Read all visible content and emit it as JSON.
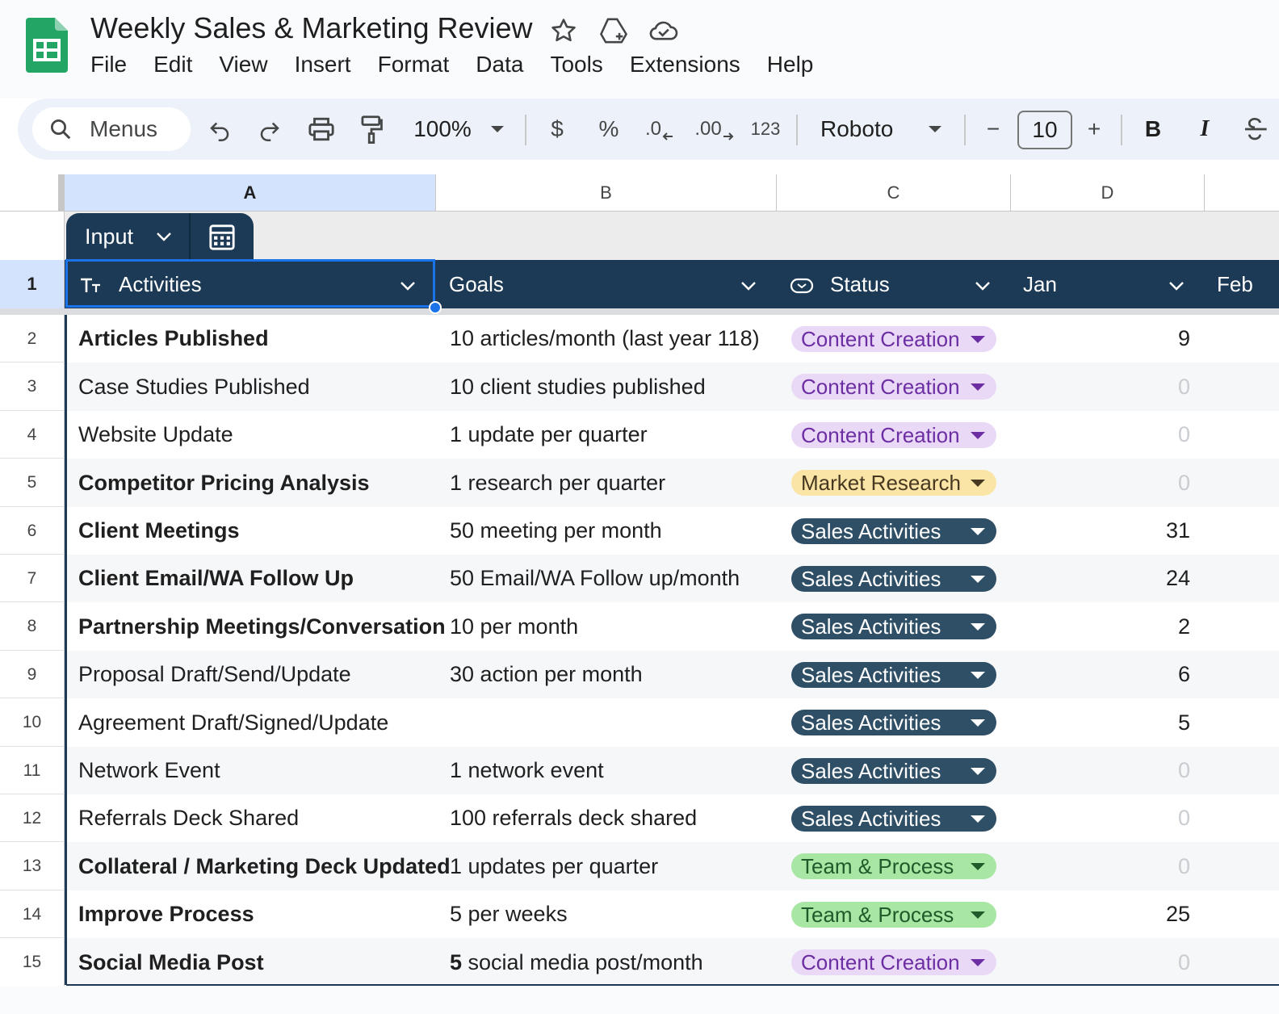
{
  "app": {
    "title": "Weekly Sales & Marketing Review",
    "menu": [
      "File",
      "Edit",
      "View",
      "Insert",
      "Format",
      "Data",
      "Tools",
      "Extensions",
      "Help"
    ]
  },
  "toolbar": {
    "search_label": "Menus",
    "zoom": "100%",
    "currency": "$",
    "percent": "%",
    "decrease_decimal": ".0",
    "increase_decimal": ".00",
    "number_format": "123",
    "font": "Roboto",
    "font_size": "10",
    "minus": "−",
    "plus": "+",
    "bold": "B",
    "italic": "I"
  },
  "columns": [
    "A",
    "B",
    "C",
    "D"
  ],
  "table": {
    "name": "Input",
    "header_row_number": "1",
    "headers": {
      "activities": "Activities",
      "goals": "Goals",
      "status": "Status",
      "jan": "Jan",
      "feb": "Feb"
    }
  },
  "status_colors": {
    "Content Creation": {
      "bg": "#e9d9f6",
      "fg": "#6c2ea2"
    },
    "Market Research": {
      "bg": "#fbe5a6",
      "fg": "#473821"
    },
    "Sales Activities": {
      "bg": "#2f4f66",
      "fg": "#ffffff"
    },
    "Team & Process": {
      "bg": "#a8e6a3",
      "fg": "#1f5a2a"
    }
  },
  "rows": [
    {
      "n": "2",
      "activity": "Articles Published",
      "bold": true,
      "goal": "10 articles/month (last year 118)",
      "status": "Content Creation",
      "jan": "9"
    },
    {
      "n": "3",
      "activity": "Case Studies Published",
      "bold": false,
      "goal": "10 client studies published",
      "status": "Content Creation",
      "jan": "0"
    },
    {
      "n": "4",
      "activity": "Website Update",
      "bold": false,
      "goal": "1 update per quarter",
      "status": "Content Creation",
      "jan": "0"
    },
    {
      "n": "5",
      "activity": "Competitor Pricing Analysis",
      "bold": true,
      "goal": "1 research per quarter",
      "status": "Market Research",
      "jan": "0"
    },
    {
      "n": "6",
      "activity": "Client Meetings",
      "bold": true,
      "goal": "50 meeting per month",
      "status": "Sales Activities",
      "jan": "31"
    },
    {
      "n": "7",
      "activity": "Client Email/WA Follow Up",
      "bold": true,
      "goal": "50 Email/WA Follow up/month",
      "status": "Sales Activities",
      "jan": "24"
    },
    {
      "n": "8",
      "activity": "Partnership Meetings/Conversation",
      "bold": true,
      "goal": "10 per month",
      "status": "Sales Activities",
      "jan": "2"
    },
    {
      "n": "9",
      "activity": "Proposal Draft/Send/Update",
      "bold": false,
      "goal": "30 action per month",
      "status": "Sales Activities",
      "jan": "6"
    },
    {
      "n": "10",
      "activity": "Agreement Draft/Signed/Update",
      "bold": false,
      "goal": "",
      "status": "Sales Activities",
      "jan": "5"
    },
    {
      "n": "11",
      "activity": "Network Event",
      "bold": false,
      "goal": "1 network event",
      "status": "Sales Activities",
      "jan": "0"
    },
    {
      "n": "12",
      "activity": "Referrals Deck Shared",
      "bold": false,
      "goal": "100 referrals deck shared",
      "status": "Sales Activities",
      "jan": "0"
    },
    {
      "n": "13",
      "activity": "Collateral / Marketing Deck Updated",
      "bold": true,
      "goal": "1 updates per quarter",
      "status": "Team & Process",
      "jan": "0"
    },
    {
      "n": "14",
      "activity": "Improve Process",
      "bold": true,
      "goal": "5 per weeks",
      "status": "Team & Process",
      "jan": "25"
    },
    {
      "n": "15",
      "activity": "Social Media Post",
      "bold": true,
      "goal_bold_prefix": "5",
      "goal": " social media post/month",
      "status": "Content Creation",
      "jan": "0"
    }
  ]
}
